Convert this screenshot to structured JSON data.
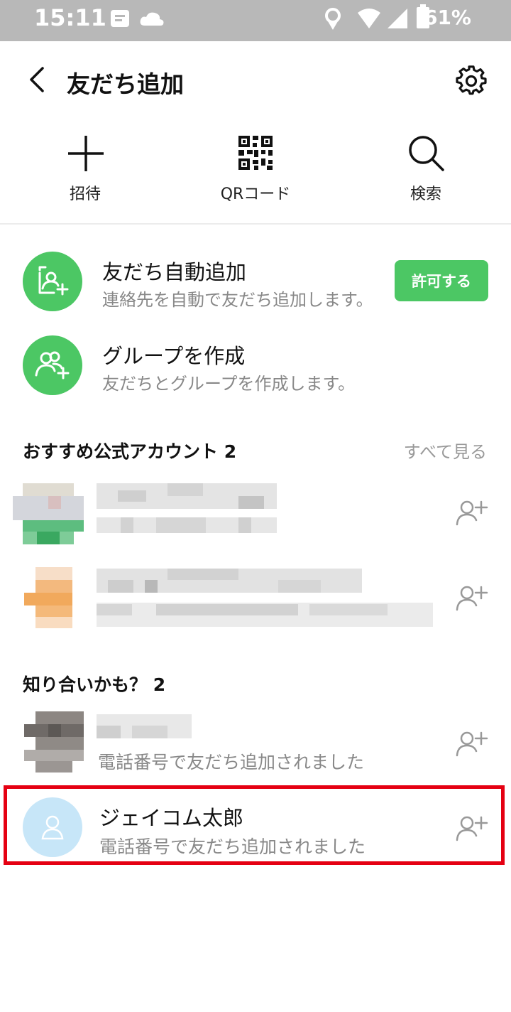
{
  "status_bar": {
    "time": "15:11",
    "battery": "61%"
  },
  "header": {
    "title": "友だち追加"
  },
  "shortcuts": [
    {
      "label": "招待",
      "icon": "plus-icon"
    },
    {
      "label": "QRコード",
      "icon": "qr-code-icon"
    },
    {
      "label": "検索",
      "icon": "search-icon"
    }
  ],
  "auto_add": {
    "title": "友だち自動追加",
    "subtitle": "連絡先を自動で友だち追加します。",
    "button": "許可する"
  },
  "create_group": {
    "title": "グループを作成",
    "subtitle": "友だちとグループを作成します。"
  },
  "recommended": {
    "title": "おすすめ公式アカウント 2",
    "see_all": "すべて見る"
  },
  "people_may_know": {
    "title": "知り合いかも？ 2",
    "items": [
      {
        "subtitle": "電話番号で友だち追加されました"
      },
      {
        "name": "ジェイコム太郎",
        "subtitle": "電話番号で友だち追加されました"
      }
    ]
  },
  "colors": {
    "accent_green": "#4cc764",
    "highlight_red": "#e50012",
    "status_bar": "#b8b8b8"
  }
}
